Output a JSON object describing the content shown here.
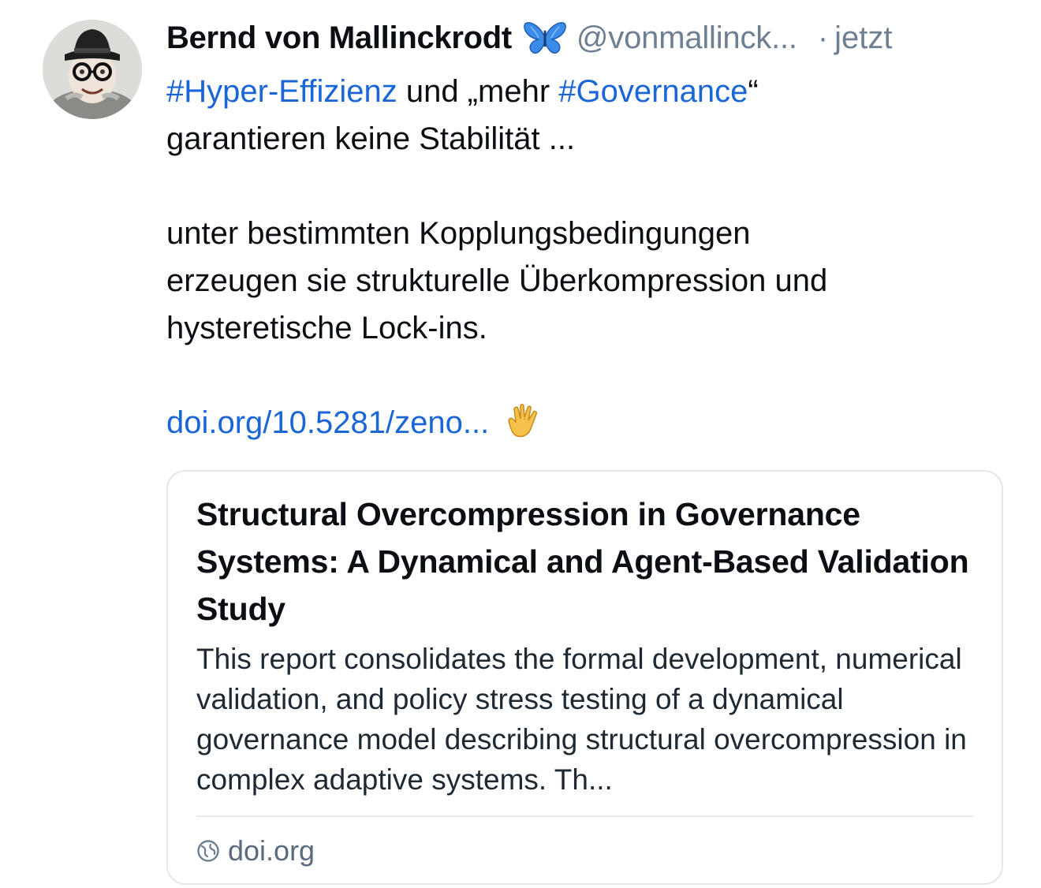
{
  "post": {
    "author_name": "Bernd von Mallinckrodt",
    "author_badge_icon": "butterfly-icon",
    "handle": "@vonmallinck...",
    "timestamp_separator": "·",
    "timestamp": "jetzt",
    "text": {
      "hashtag1": "#Hyper-Effizienz",
      "segment1": " und „mehr ",
      "hashtag2": "#Governance",
      "segment2": "“",
      "line2": "garantieren keine Stabilität ...",
      "paragraph2_line1": "unter bestimmten Kopplungsbedingungen",
      "paragraph2_line2": "erzeugen sie strukturelle Überkompression und",
      "paragraph2_line3": "hysteretische Lock-ins.",
      "link": "doi.org/10.5281/zeno...",
      "link_emoji_icon": "vulcan-salute-icon"
    },
    "link_card": {
      "title": "Structural Overcompression in Governance Systems: A Dynamical and Agent-Based Validation Study",
      "description": "This report consolidates the formal development, numerical validation, and policy stress testing of a dynamical governance model describing structural overcompression in complex adaptive systems. Th...",
      "domain_icon": "globe-icon",
      "domain": "doi.org"
    }
  },
  "colors": {
    "link": "#1a66d6",
    "muted": "#6f7f92",
    "text": "#0b0f14",
    "card_border": "#e3e7ec"
  }
}
